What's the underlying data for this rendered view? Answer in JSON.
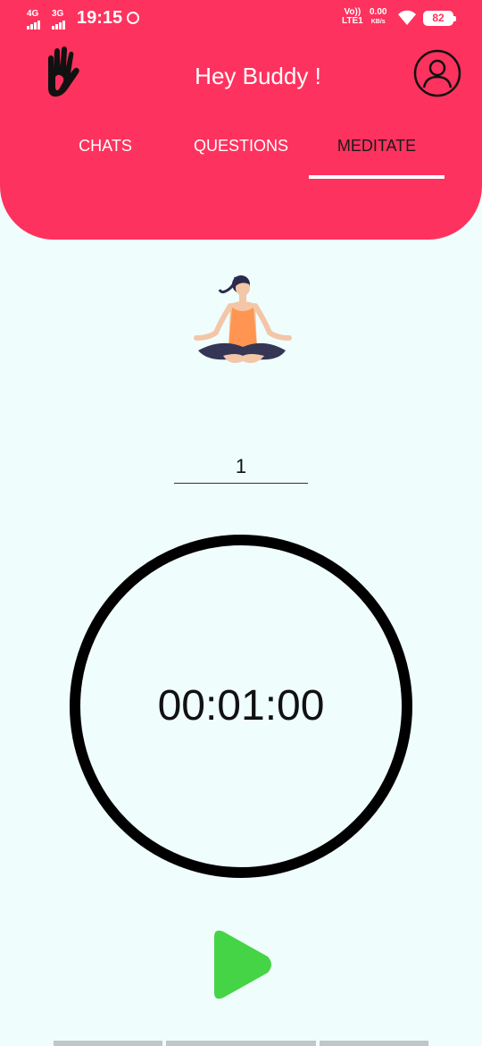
{
  "status_bar": {
    "network_1": "4G",
    "network_2": "3G",
    "time": "19:15",
    "volte_top": "Vo))",
    "volte_bottom": "LTE1",
    "speed_value": "0.00",
    "speed_unit": "KB/s",
    "battery": "82"
  },
  "header": {
    "title": "Hey Buddy !",
    "background_color": "#fe325e"
  },
  "tabs": [
    {
      "label": "CHATS",
      "active": false
    },
    {
      "label": "QUESTIONS",
      "active": false
    },
    {
      "label": "MEDITATE",
      "active": true
    }
  ],
  "icons": {
    "logo": "hand-icon",
    "profile": "profile-icon",
    "play": "play-icon"
  },
  "meditate": {
    "minutes_value": "1",
    "timer": "00:01:00",
    "play_color": "#45d445"
  }
}
